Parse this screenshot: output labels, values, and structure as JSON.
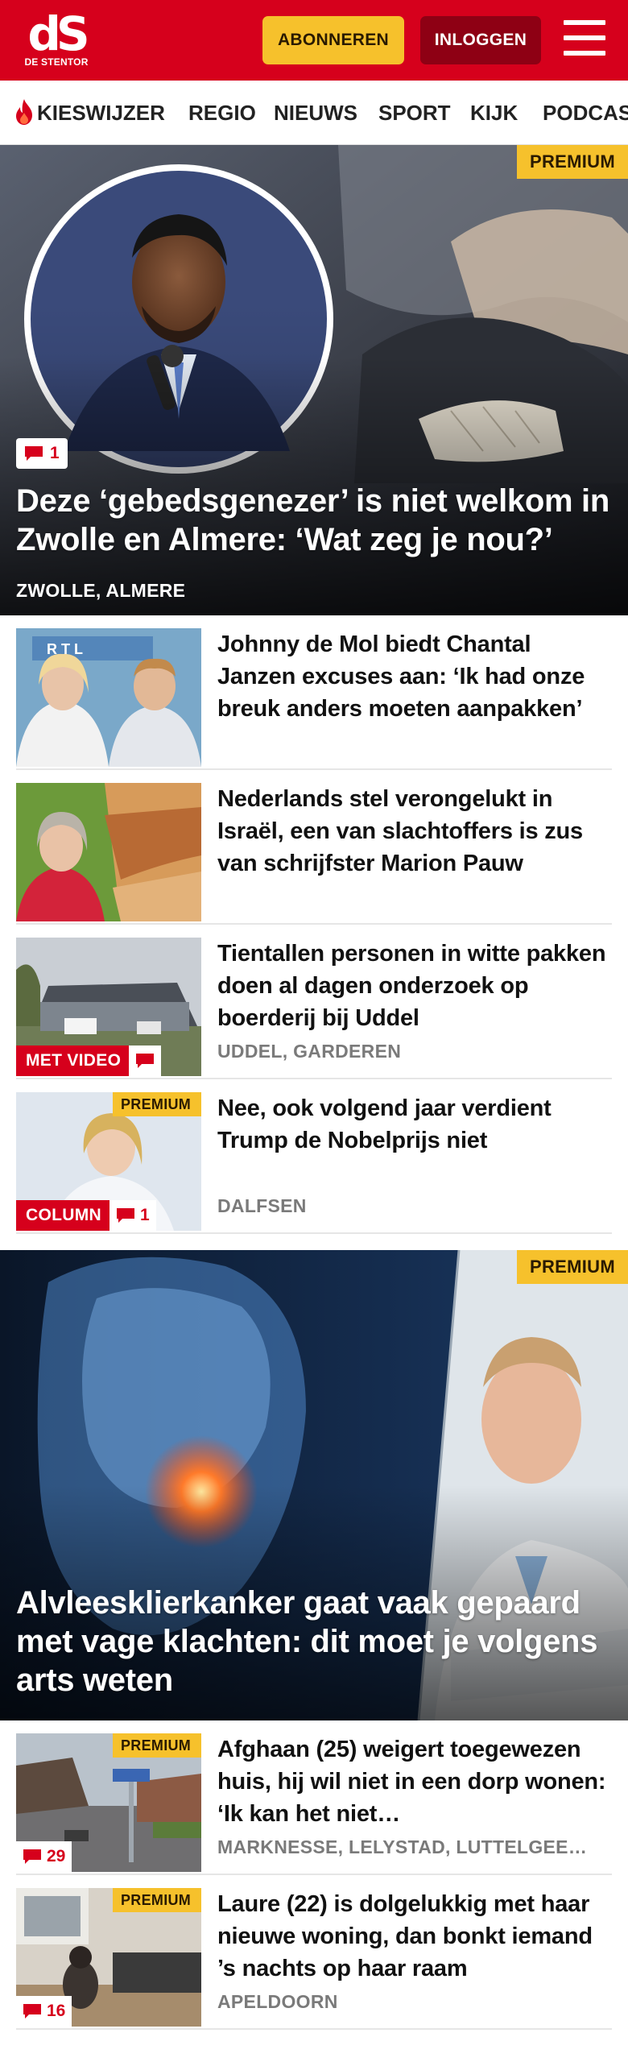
{
  "header": {
    "logo_mark": "dS",
    "logo_sub": "DE STENTOR",
    "subscribe_label": "ABONNEREN",
    "login_label": "INLOGGEN",
    "menu_icon": "hamburger-menu-icon",
    "brand_color": "#d6001c",
    "accent_color": "#f6c12c"
  },
  "nav": {
    "items": [
      {
        "label": "KIESWIJZER",
        "icon": "flame-icon"
      },
      {
        "label": "REGIO"
      },
      {
        "label": "NIEUWS"
      },
      {
        "label": "SPORT"
      },
      {
        "label": "KIJK"
      },
      {
        "label": "PODCAS"
      }
    ]
  },
  "hero1": {
    "badge": "PREMIUM",
    "comments": "1",
    "title": "Deze ‘gebedsgenezer’ is niet welkom in Zwolle en Almere: ‘Wat zeg je nou?’",
    "location": "ZWOLLE, ALMERE"
  },
  "articles1": [
    {
      "title": "Johnny de Mol biedt Chantal Janzen excuses aan: ‘Ik had onze breuk anders moeten aanpakken’"
    },
    {
      "title": "Nederlands stel verongelukt in Israël, een van slachtoffers is zus van schrijfster Marion Pauw"
    },
    {
      "title": "Tientallen personen in witte pakken doen al dagen onderzoek op boerderij bij Uddel",
      "location": "UDDEL, GARDEREN",
      "tag": "MET VIDEO"
    },
    {
      "title": "Nee, ook volgend jaar verdient Trump de Nobelprijs niet",
      "location": "DALFSEN",
      "tag": "COLUMN",
      "badge": "PREMIUM",
      "comments": "1"
    }
  ],
  "hero2": {
    "badge": "PREMIUM",
    "title": "Alvleesklierkanker gaat vaak gepaard met vage klachten: dit moet je volgens arts weten"
  },
  "articles2": [
    {
      "title": "Afghaan (25) weigert toegewezen huis, hij wil niet in een dorp wonen: ‘Ik kan het niet…",
      "location": "MARKNESSE, LELYSTAD, LUTTELGEE…",
      "badge": "PREMIUM",
      "comments": "29"
    },
    {
      "title": "Laure (22) is dolgelukkig met haar nieuwe woning, dan bonkt iemand ’s nachts op haar raam",
      "location": "APELDOORN",
      "badge": "PREMIUM",
      "comments": "16"
    }
  ]
}
